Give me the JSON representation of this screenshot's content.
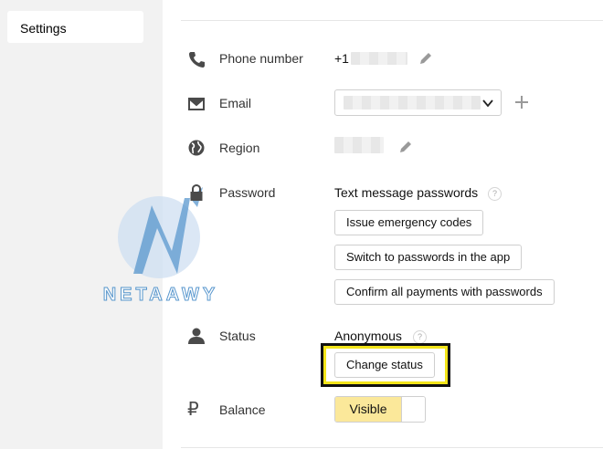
{
  "sidebar": {
    "items": [
      {
        "label": "Settings"
      }
    ]
  },
  "rows": {
    "phone": {
      "label": "Phone number",
      "value_prefix": "+1"
    },
    "email": {
      "label": "Email"
    },
    "region": {
      "label": "Region"
    },
    "password": {
      "label": "Password",
      "mode": "Text message passwords",
      "buttons": [
        "Issue emergency codes",
        "Switch to passwords in the app",
        "Confirm all payments with passwords"
      ]
    },
    "status": {
      "label": "Status",
      "value": "Anonymous",
      "button": "Change status"
    },
    "balance": {
      "label": "Balance",
      "toggle_label": "Visible"
    }
  },
  "help_mark": "?",
  "watermark": {
    "text": "NETAAWY"
  },
  "colors": {
    "sidebar_bg": "#f2f2f2",
    "toggle_on": "#fbe89a",
    "highlight_outer": "#111111",
    "highlight_inner": "#f3e51a",
    "watermark": "#3d86c6"
  }
}
